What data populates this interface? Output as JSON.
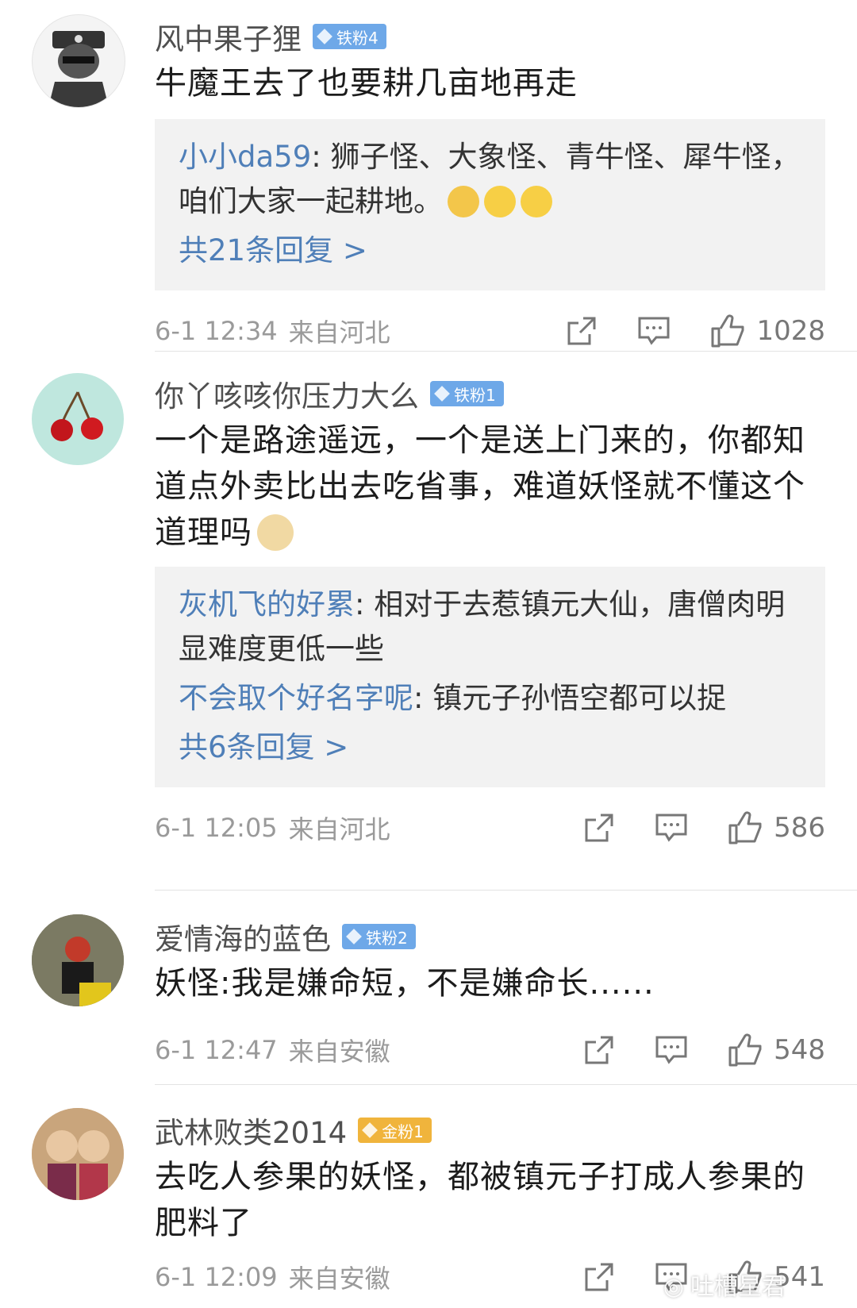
{
  "comments": [
    {
      "username": "风中果子狸",
      "badge": "铁粉4",
      "text": "牛魔王去了也要耕几亩地再走",
      "replies": [
        {
          "name": "小小da59",
          "text": ": 狮子怪、大象怪、青牛怪、犀牛怪，咱们大家一起耕地。"
        }
      ],
      "more": "共21条回复 >",
      "time": "6-1 12:34",
      "location": "来自河北",
      "likes": "1028"
    },
    {
      "username": "你丫咳咳你压力大么",
      "badge": "铁粉1",
      "text": "一个是路途遥远，一个是送上门来的，你都知道点外卖比出去吃省事，难道妖怪就不懂这个道理吗",
      "replies": [
        {
          "name": "灰机飞的好累",
          "text": ": 相对于去惹镇元大仙，唐僧肉明显难度更低一些"
        },
        {
          "name": "不会取个好名字呢",
          "text": ": 镇元子孙悟空都可以捉"
        }
      ],
      "more": "共6条回复 >",
      "time": "6-1 12:05",
      "location": "来自河北",
      "likes": "586"
    },
    {
      "username": "爱情海的蓝色",
      "badge": "铁粉2",
      "text": "妖怪:我是嫌命短，不是嫌命长......",
      "time": "6-1 12:47",
      "location": "来自安徽",
      "likes": "548"
    },
    {
      "username": "武林败类2014",
      "badge": "金粉1",
      "text": "去吃人参果的妖怪，都被镇元子打成人参果的肥料了",
      "time": "6-1 12:09",
      "location": "来自安徽",
      "likes": "541"
    }
  ],
  "watermark": "吐槽星君",
  "colors": {
    "link": "#4f7fb8",
    "iron_badge": "#6ea8e8",
    "gold_badge": "#f0b43c"
  }
}
